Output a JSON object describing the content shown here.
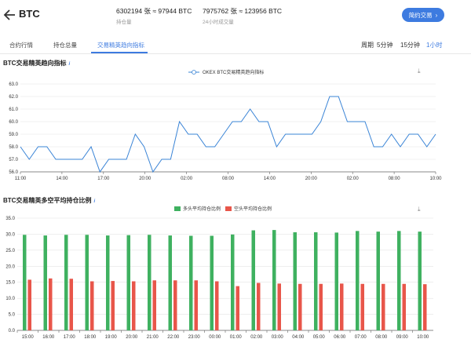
{
  "header": {
    "back_icon": "arrow-left-icon",
    "symbol": "BTC",
    "holdings": {
      "value": "6302194 张 ≈ 97944 BTC",
      "label": "持仓量"
    },
    "volume": {
      "value": "7975762 张 ≈ 123956 BTC",
      "label": "24小时成交量"
    },
    "contract_button": "简约交易",
    "contract_icon": "chevron-right-icon"
  },
  "tabs": [
    {
      "label": "合约行情"
    },
    {
      "label": "持仓总量"
    },
    {
      "label": "交易精英趋向指标"
    }
  ],
  "period": {
    "label": "周期",
    "options": [
      "5分钟",
      "15分钟",
      "1小时"
    ],
    "selected": "1小时"
  },
  "colors": {
    "accent": "#3d7be0",
    "line": "#3a84d6",
    "long": "#3fb160",
    "short": "#e8564a"
  },
  "chart1_title": "BTC交易精英趋向指标",
  "chart2_title": "BTC交易精英多空平均持仓比例",
  "chart_data": [
    {
      "type": "line",
      "legend": "OKEX BTC交易精英趋向指标",
      "ylim": [
        56.0,
        63.0
      ],
      "yticks": [
        "56.0",
        "57.0",
        "58.0",
        "59.0",
        "60.0",
        "61.0",
        "62.0",
        "63.0"
      ],
      "xtick_labels": [
        "11:00",
        "14:00",
        "17:00",
        "20:00",
        "02:00",
        "08:00",
        "14:00",
        "20:00",
        "02:00",
        "08:00",
        "10:00"
      ],
      "grid": true,
      "values": [
        58,
        57,
        58,
        58,
        57,
        57,
        57,
        57,
        58,
        56,
        57,
        57,
        57,
        59,
        58,
        56,
        57,
        57,
        60,
        59,
        59,
        58,
        58,
        59,
        60,
        60,
        61,
        60,
        60,
        58,
        59,
        59,
        59,
        59,
        60,
        62,
        62,
        60,
        60,
        60,
        58,
        58,
        59,
        58,
        59,
        59,
        58,
        59
      ]
    },
    {
      "type": "bar",
      "legend": [
        "多头平均持仓比例",
        "空头平均持仓比例"
      ],
      "ylim": [
        0,
        35.0
      ],
      "yticks": [
        "0.0",
        "5.0",
        "10.0",
        "15.0",
        "20.0",
        "25.0",
        "30.0",
        "35.0"
      ],
      "grid": true,
      "categories": [
        "15:00",
        "16:00",
        "17:00",
        "18:00",
        "19:00",
        "20:00",
        "21:00",
        "22:00",
        "23:00",
        "00:00",
        "01:00",
        "02:00",
        "03:00",
        "04:00",
        "05:00",
        "06:00",
        "07:00",
        "08:00",
        "09:00",
        "10:00"
      ],
      "series": [
        {
          "name": "多头平均持仓比例",
          "values": [
            29.8,
            29.6,
            29.8,
            29.8,
            29.6,
            29.7,
            29.8,
            29.6,
            29.5,
            29.5,
            29.9,
            31.2,
            31.3,
            30.6,
            30.6,
            30.5,
            31.0,
            30.8,
            31.0,
            30.8
          ]
        },
        {
          "name": "空头平均持仓比例",
          "values": [
            15.8,
            16.2,
            16.1,
            15.3,
            15.4,
            15.3,
            15.6,
            15.6,
            15.6,
            15.3,
            13.8,
            14.8,
            14.6,
            14.5,
            14.5,
            14.6,
            14.5,
            14.5,
            14.5,
            14.4
          ]
        }
      ]
    }
  ]
}
